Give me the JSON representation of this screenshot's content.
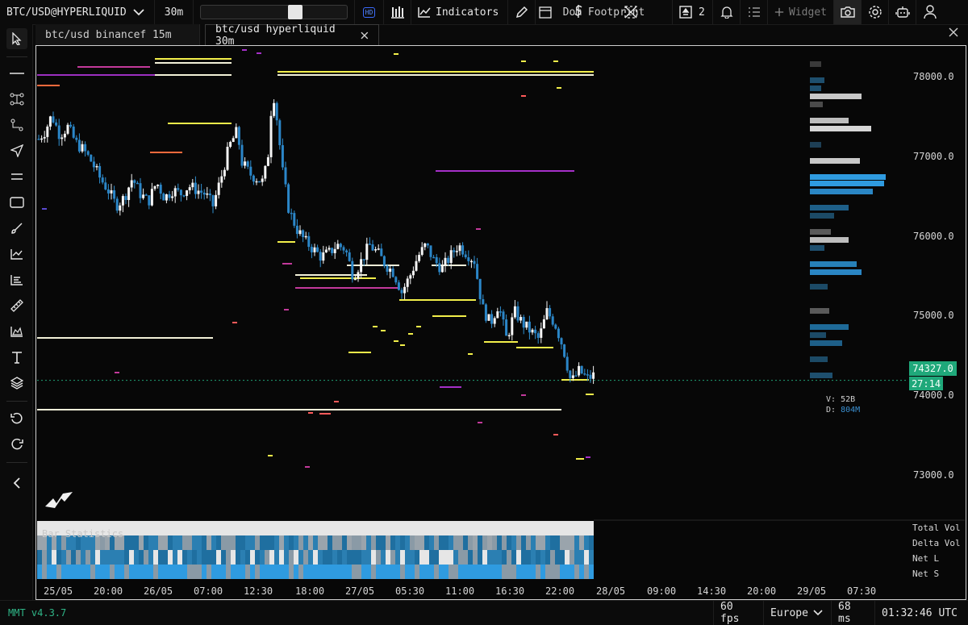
{
  "topbar": {
    "symbol": "BTC/USD@HYPERLIQUID",
    "timeframe": "30m",
    "hd_label": "HD",
    "indicators_label": "Indicators",
    "overlay_text": "Dom Footprint",
    "layout_count": "2",
    "widget_label": "Widget"
  },
  "tabs": [
    {
      "label": "btc/usd binancef 15m",
      "active": false
    },
    {
      "label": "btc/usd hyperliquid 30m",
      "active": true
    }
  ],
  "price_axis": [
    "78000.0",
    "77000.0",
    "76000.0",
    "75000.0",
    "74000.0",
    "73000.0"
  ],
  "last_price": "74327.0",
  "countdown": "27:14",
  "vd_box": {
    "v_label": "V:",
    "v_value": "52B",
    "d_label": "D:",
    "d_value": "804M"
  },
  "bar_statistics": {
    "title": "Bar Statistics",
    "rows": [
      "Total Vol",
      "Delta Vol",
      "Net L",
      "Net S"
    ]
  },
  "time_axis": [
    "25/05",
    "20:00",
    "26/05",
    "07:00",
    "12:30",
    "18:00",
    "27/05",
    "05:30",
    "11:00",
    "16:30",
    "22:00",
    "28/05",
    "09:00",
    "14:30",
    "20:00",
    "29/05",
    "07:30"
  ],
  "statusbar": {
    "version": "MMT v4.3.7",
    "fps": "60 fps",
    "region": "Europe",
    "latency": "68 ms",
    "clock": "01:32:46 UTC"
  },
  "chart_data": {
    "type": "candlestick",
    "symbol": "BTC/USD@HYPERLIQUID",
    "interval": "30m",
    "y_ticks": [
      78000,
      77000,
      76000,
      75000,
      74000,
      73000
    ],
    "ylim": [
      72600,
      78550
    ],
    "x_ticks": [
      "25/05",
      "20:00",
      "26/05",
      "07:00",
      "12:30",
      "18:00",
      "27/05",
      "05:30",
      "11:00",
      "16:30",
      "22:00",
      "28/05",
      "09:00",
      "14:30",
      "20:00",
      "29/05",
      "07:30"
    ],
    "last_price": 74327.0,
    "price_path": [
      [
        0,
        77400
      ],
      [
        8,
        77500
      ],
      [
        16,
        77700
      ],
      [
        26,
        77450
      ],
      [
        36,
        77550
      ],
      [
        46,
        77350
      ],
      [
        56,
        77250
      ],
      [
        66,
        77100
      ],
      [
        76,
        76900
      ],
      [
        86,
        76750
      ],
      [
        96,
        76550
      ],
      [
        106,
        76650
      ],
      [
        116,
        76900
      ],
      [
        126,
        76700
      ],
      [
        136,
        76600
      ],
      [
        146,
        76850
      ],
      [
        156,
        76650
      ],
      [
        166,
        76750
      ],
      [
        176,
        76700
      ],
      [
        186,
        76800
      ],
      [
        196,
        76750
      ],
      [
        206,
        76700
      ],
      [
        216,
        76550
      ],
      [
        226,
        76900
      ],
      [
        236,
        77300
      ],
      [
        246,
        77500
      ],
      [
        252,
        77100
      ],
      [
        262,
        76950
      ],
      [
        270,
        76900
      ],
      [
        278,
        76850
      ],
      [
        284,
        77150
      ],
      [
        290,
        78050
      ],
      [
        296,
        77600
      ],
      [
        302,
        77000
      ],
      [
        310,
        76500
      ],
      [
        320,
        76250
      ],
      [
        330,
        76100
      ],
      [
        340,
        76000
      ],
      [
        350,
        75900
      ],
      [
        360,
        75950
      ],
      [
        370,
        76050
      ],
      [
        380,
        76000
      ],
      [
        390,
        75650
      ],
      [
        400,
        75850
      ],
      [
        410,
        76050
      ],
      [
        420,
        75950
      ],
      [
        430,
        75800
      ],
      [
        440,
        75700
      ],
      [
        450,
        75450
      ],
      [
        460,
        75650
      ],
      [
        470,
        75900
      ],
      [
        480,
        76050
      ],
      [
        490,
        75850
      ],
      [
        500,
        75750
      ],
      [
        510,
        75900
      ],
      [
        520,
        76050
      ],
      [
        530,
        75950
      ],
      [
        540,
        75850
      ],
      [
        550,
        75250
      ],
      [
        560,
        75050
      ],
      [
        570,
        75300
      ],
      [
        580,
        74850
      ],
      [
        590,
        75200
      ],
      [
        600,
        75050
      ],
      [
        610,
        74950
      ],
      [
        620,
        74850
      ],
      [
        630,
        75200
      ],
      [
        640,
        75050
      ],
      [
        650,
        74750
      ],
      [
        660,
        74300
      ],
      [
        670,
        74450
      ],
      [
        680,
        74350
      ],
      [
        690,
        74400
      ]
    ]
  }
}
